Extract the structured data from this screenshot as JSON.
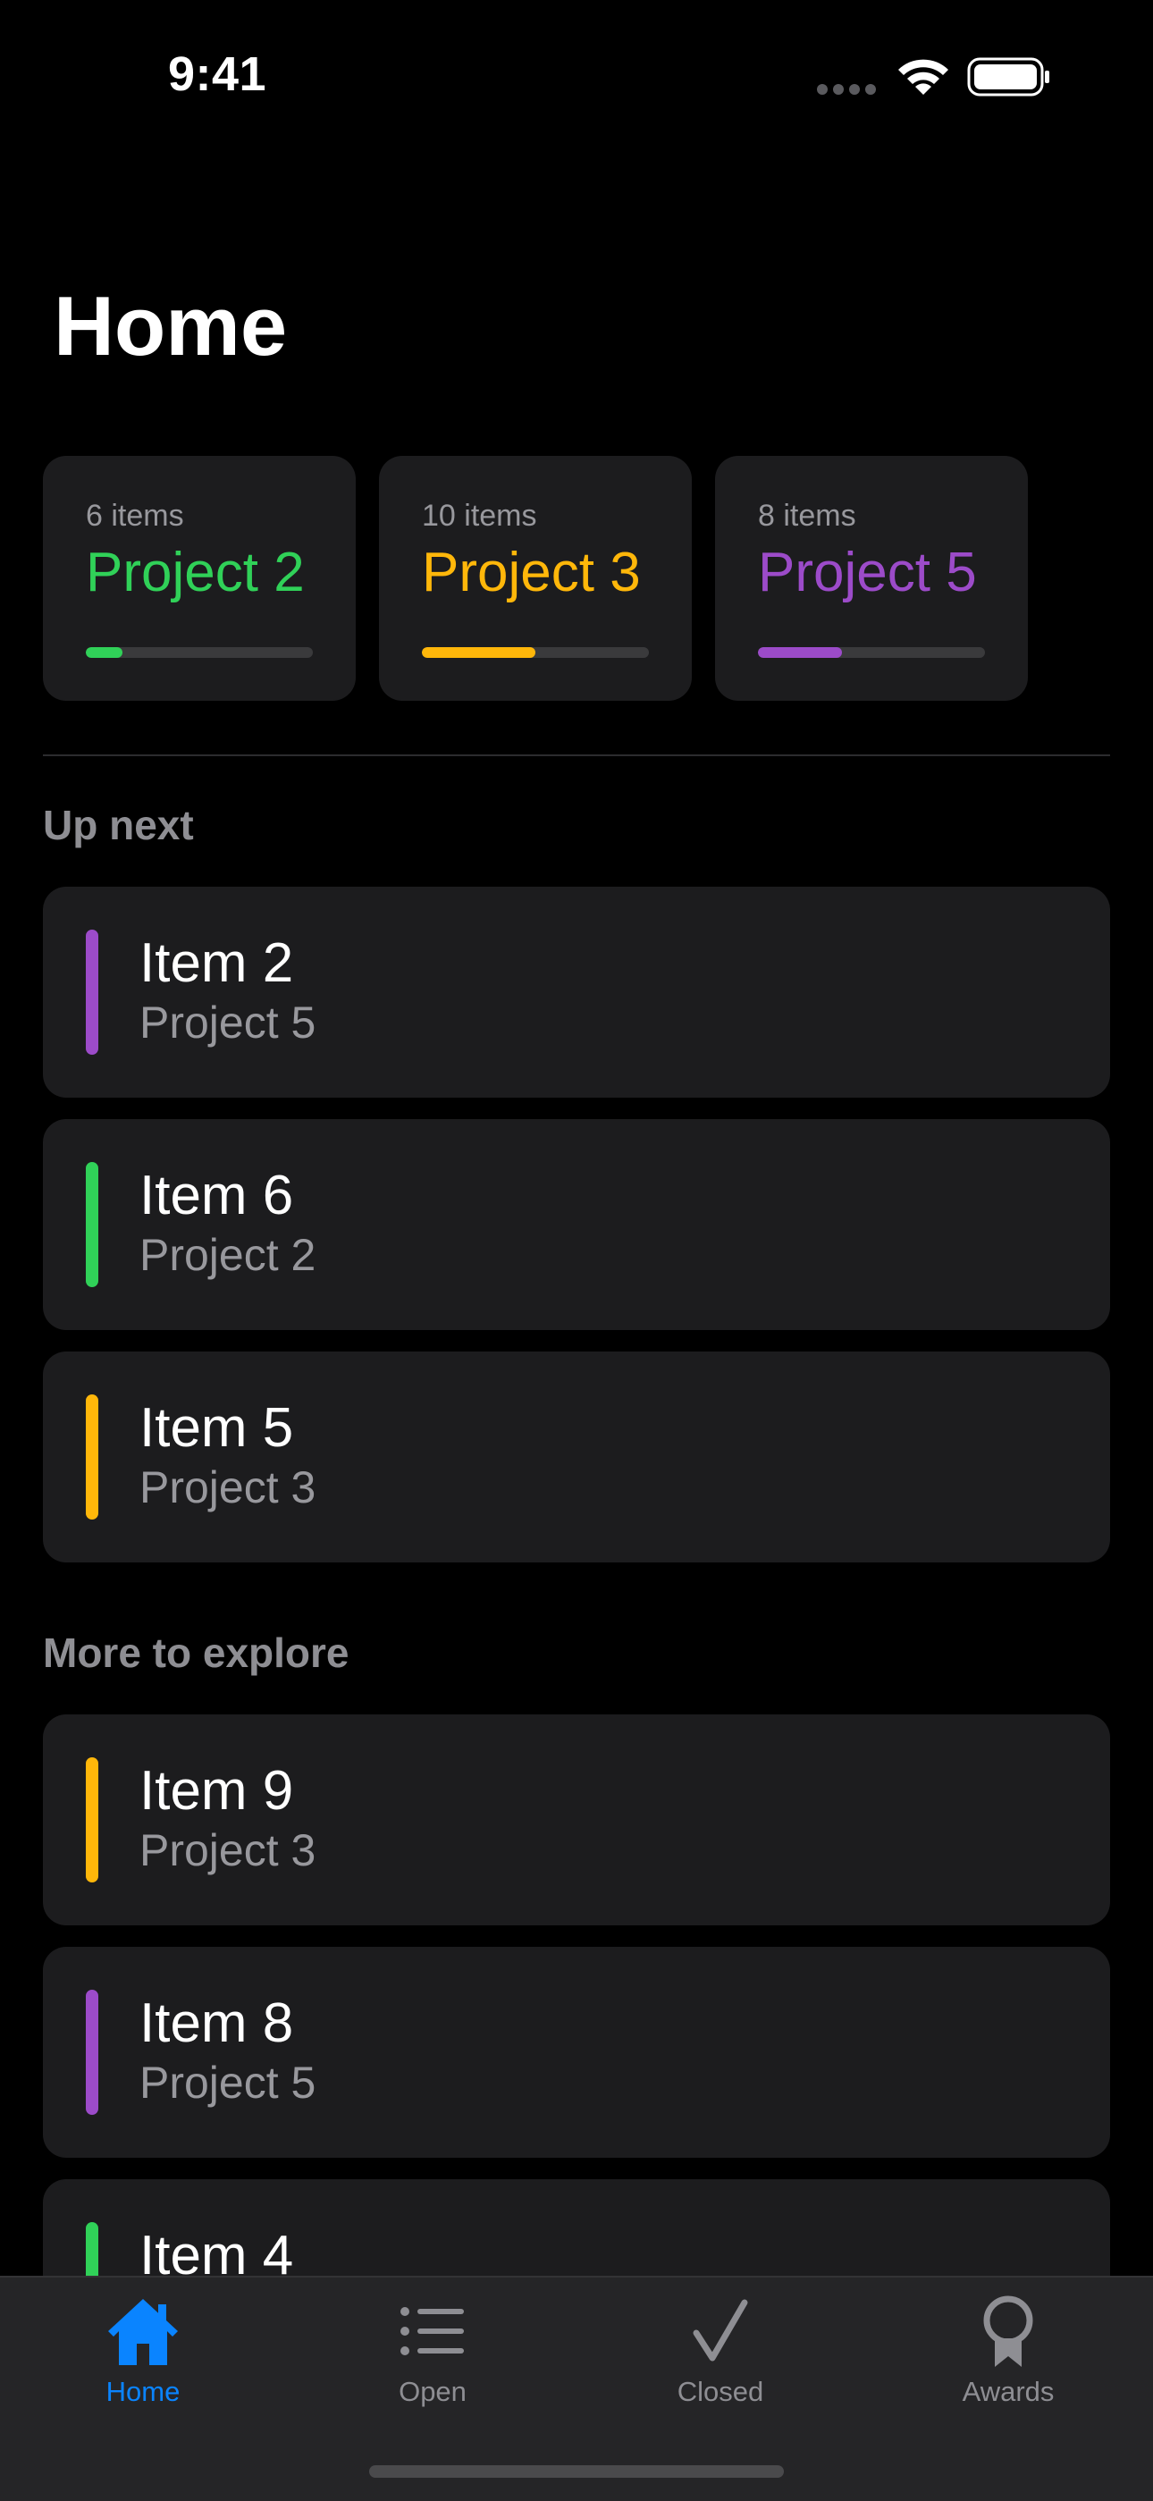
{
  "status_bar": {
    "time": "9:41"
  },
  "page": {
    "title": "Home"
  },
  "projects": [
    {
      "count_label": "6 items",
      "name": "Project 2",
      "color": "#30d158",
      "progress": 0.16
    },
    {
      "count_label": "10 items",
      "name": "Project 3",
      "color": "#ffb70a",
      "progress": 0.5
    },
    {
      "count_label": "8 items",
      "name": "Project 5",
      "color": "#9c4bc9",
      "progress": 0.37
    }
  ],
  "sections": {
    "up_next": {
      "title": "Up next",
      "items": [
        {
          "title": "Item 2",
          "project": "Project 5",
          "color": "#9c4bc9"
        },
        {
          "title": "Item 6",
          "project": "Project 2",
          "color": "#30d158"
        },
        {
          "title": "Item 5",
          "project": "Project 3",
          "color": "#ffb70a"
        }
      ]
    },
    "more_to_explore": {
      "title": "More to explore",
      "items": [
        {
          "title": "Item 9",
          "project": "Project 3",
          "color": "#ffb70a"
        },
        {
          "title": "Item 8",
          "project": "Project 5",
          "color": "#9c4bc9"
        },
        {
          "title": "Item 4",
          "project": "",
          "color": "#30d158"
        }
      ]
    }
  },
  "tab_bar": {
    "tabs": [
      {
        "label": "Home",
        "icon": "house-icon",
        "active": true
      },
      {
        "label": "Open",
        "icon": "list-icon",
        "active": false
      },
      {
        "label": "Closed",
        "icon": "checkmark-icon",
        "active": false
      },
      {
        "label": "Awards",
        "icon": "award-icon",
        "active": false
      }
    ]
  },
  "colors": {
    "accent": "#0a84ff",
    "background": "#000000",
    "card": "#1c1c1e"
  }
}
